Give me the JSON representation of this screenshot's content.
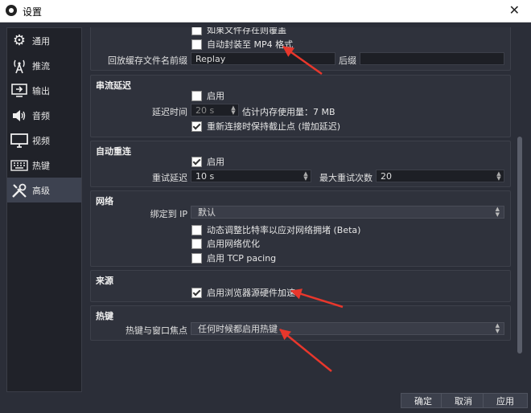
{
  "window": {
    "title": "设置",
    "close_glyph": "✕"
  },
  "sidebar": {
    "items": [
      {
        "label": "通用",
        "icon": "gear-icon"
      },
      {
        "label": "推流",
        "icon": "antenna-icon"
      },
      {
        "label": "输出",
        "icon": "output-icon"
      },
      {
        "label": "音频",
        "icon": "speaker-icon"
      },
      {
        "label": "视频",
        "icon": "monitor-icon"
      },
      {
        "label": "热键",
        "icon": "keyboard-icon"
      },
      {
        "label": "高级",
        "icon": "tools-icon"
      }
    ],
    "active_index": 6
  },
  "recording": {
    "partial_top": "如果文件存在则覆盖",
    "auto_remux": "自动封装至 MP4 格式",
    "auto_remux_checked": false,
    "replay_prefix_label": "回放缓存文件名前缀",
    "replay_prefix_value": "Replay",
    "replay_suffix_label": "后缀",
    "replay_suffix_value": ""
  },
  "stream_delay": {
    "title": "串流延迟",
    "enable_label": "启用",
    "enable_checked": false,
    "duration_label": "延迟时间",
    "duration_value": "20 s",
    "memory_estimate": "估计内存使用量：7 MB",
    "preserve_label": "重新连接时保持截止点 (增加延迟)",
    "preserve_checked": true
  },
  "auto_reconnect": {
    "title": "自动重连",
    "enable_label": "启用",
    "enable_checked": true,
    "retry_delay_label": "重试延迟",
    "retry_delay_value": "10 s",
    "max_retries_label": "最大重试次数",
    "max_retries_value": "20"
  },
  "network": {
    "title": "网络",
    "bind_ip_label": "绑定到 IP",
    "bind_ip_value": "默认",
    "dynamic_bitrate_label": "动态调整比特率以应对网络拥堵 (Beta)",
    "dynamic_bitrate_checked": false,
    "network_opt_label": "启用网络优化",
    "network_opt_checked": false,
    "tcp_pacing_label": "启用 TCP pacing",
    "tcp_pacing_checked": false
  },
  "sources": {
    "title": "来源",
    "browser_hw_label": "启用浏览器源硬件加速",
    "browser_hw_checked": true
  },
  "hotkeys": {
    "title": "热键",
    "focus_label": "热键与窗口焦点",
    "focus_value": "任何时候都启用热键"
  },
  "buttons": {
    "ok": "确定",
    "cancel": "取消",
    "apply": "应用"
  },
  "colors": {
    "annotation_arrow": "#e8372c",
    "background": "#2b2e38"
  }
}
